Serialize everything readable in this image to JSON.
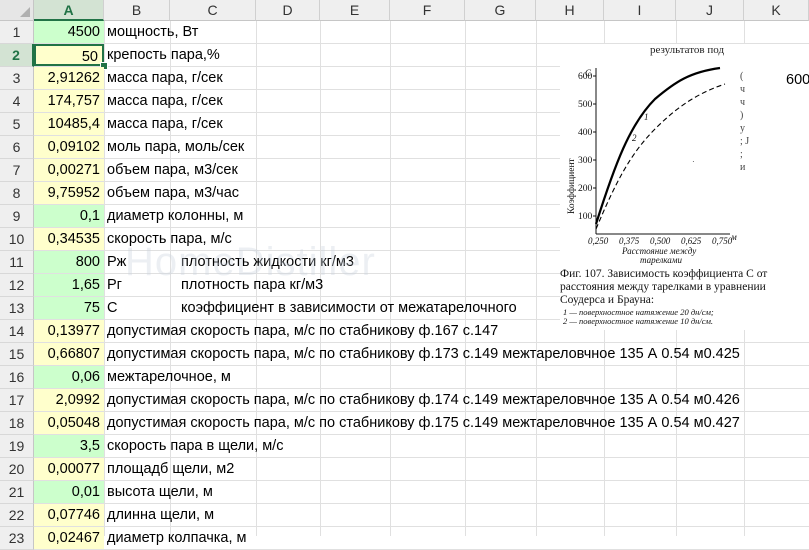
{
  "columns": [
    "A",
    "B",
    "C",
    "D",
    "E",
    "F",
    "G",
    "H",
    "I",
    "J",
    "K"
  ],
  "selected_column": "A",
  "selected_row": "2",
  "rows": [
    {
      "num": "1",
      "a": "4500",
      "fill": "grn",
      "b": "мощность, Вт"
    },
    {
      "num": "2",
      "a": "50",
      "fill": "yel",
      "b": "крепость пара,%",
      "active": true
    },
    {
      "num": "3",
      "a": "2,91262",
      "fill": "yel",
      "b": "масса пара, г/сек"
    },
    {
      "num": "4",
      "a": "174,757",
      "fill": "yel",
      "b": "масса пара, г/сек"
    },
    {
      "num": "5",
      "a": "10485,4",
      "fill": "yel",
      "b": "масса пара, г/сек"
    },
    {
      "num": "6",
      "a": "0,09102",
      "fill": "yel",
      "b": "моль пара, моль/сек"
    },
    {
      "num": "7",
      "a": "0,00271",
      "fill": "yel",
      "b": "объем пара, м3/сек"
    },
    {
      "num": "8",
      "a": "9,75952",
      "fill": "yel",
      "b": "объем пара, м3/час"
    },
    {
      "num": "9",
      "a": "0,1",
      "fill": "grn",
      "b": "диаметр колонны, м"
    },
    {
      "num": "10",
      "a": "0,34535",
      "fill": "yel",
      "b": "скорость пара, м/с"
    },
    {
      "num": "11",
      "a": "800",
      "fill": "grn",
      "b": "Рж",
      "c": "плотность жидкости кг/м3"
    },
    {
      "num": "12",
      "a": "1,65",
      "fill": "grn",
      "b": "Рг",
      "c": "плотность пара кг/м3"
    },
    {
      "num": "13",
      "a": "75",
      "fill": "grn",
      "b": "С",
      "c": "коэффициент в зависимости от межатарелочного"
    },
    {
      "num": "14",
      "a": "0,13977",
      "fill": "yel",
      "b": "допустимая скорость пара, м/с по стабникову ф.167 с.147"
    },
    {
      "num": "15",
      "a": "0,66807",
      "fill": "yel",
      "b": "допустимая скорость пара, м/с по стабникову ф.173 с.149 межтареловчное 135 А 0.54 м0.425"
    },
    {
      "num": "16",
      "a": "0,06",
      "fill": "grn",
      "b": "межтарелочное, м"
    },
    {
      "num": "17",
      "a": "2,0992",
      "fill": "yel",
      "b": "допустимая скорость пара, м/с по стабникову ф.174 с.149 межтареловчное 135 А 0.54 м0.426"
    },
    {
      "num": "18",
      "a": "0,05048",
      "fill": "yel",
      "b": "допустимая скорость пара, м/с по стабникову ф.175 с.149 межтареловчное 135 А 0.54 м0.427"
    },
    {
      "num": "19",
      "a": "3,5",
      "fill": "grn",
      "b": "скорость пара в щели, м/с"
    },
    {
      "num": "20",
      "a": "0,00077",
      "fill": "yel",
      "b": "площадб щели, м2"
    },
    {
      "num": "21",
      "a": "0,01",
      "fill": "grn",
      "b": "высота щели, м"
    },
    {
      "num": "22",
      "a": "0,07746",
      "fill": "yel",
      "b": "длинна щели, м"
    },
    {
      "num": "23",
      "a": "0,02467",
      "fill": "yel",
      "b": "диаметр колпачка, м"
    }
  ],
  "k3_value": "600",
  "watermark": "HomeDistiller",
  "picture": {
    "top_text": "результатов  под",
    "y_letter": "C",
    "y_label": "Коэффициент",
    "y_ticks": [
      "600",
      "500",
      "400",
      "300",
      "200",
      "100"
    ],
    "x_ticks": [
      "0,250",
      "0,375",
      "0,500",
      "0,625",
      "0,750"
    ],
    "x_unit": "м",
    "x_caption_1": "Расстояние  между",
    "x_caption_2": "тарелками",
    "curve1": "1",
    "curve2": "2",
    "right_marks": "( ч ч ) у ; J ; и",
    "caption": "Фиг. 107. Зависимость коэффициента С от расстояния между тарелками в уравнении Соудерса и Брауна:",
    "note_1": "1 — поверхностное натяжение 20 дн/см;",
    "note_2": "2 — поверхностное натяжение 10 дн/см."
  }
}
